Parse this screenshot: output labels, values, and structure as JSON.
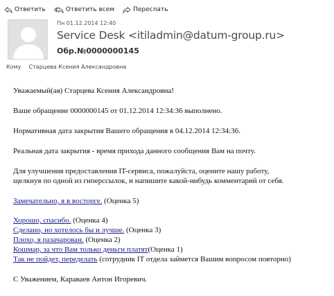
{
  "toolbar": {
    "reply": "Ответить",
    "reply_all": "Ответить всем",
    "forward": "Переслать"
  },
  "header": {
    "date": "Пн 01.12.2014 12:40",
    "sender": "Service Desk <itiladmin@datum-group.ru>",
    "subject": "Обр.№0000000145",
    "to_label": "Кому",
    "to_value": "Старцева Ксения Александровна"
  },
  "body": {
    "greeting": "Уважаемый(ая) Старцева Ксения Александровна!",
    "completed": "Ваше обращение 0000000145 от 01.12.2014 12:34:36 выполнено.",
    "normative": "Нормативная дата закрытия Вашего обращения в 04.12.2014 12:34:36.",
    "actual": "Реальная дата закрытия - время прихода данного сообщения Вам на почту.",
    "improve_1": "Для улучшения предоставления  IT-сервиса, пожалуйста, оцените нашу работу,",
    "improve_2": "щелкнув по одной из гиперссылок, и напишите какой-нибудь комментарий от себя.",
    "ratings": [
      {
        "link": "Замечательно, я в восторге.",
        "note": " (Оценка 5)"
      },
      {
        "link": "Хорошо, спасибо.",
        "note": " (Оценка 4)"
      },
      {
        "link": "Сделано, но хотелось бы и лучше.",
        "note": " (Оценка 3)"
      },
      {
        "link": "Плохо, я разачарован.",
        "note": " (Оценка 2)"
      },
      {
        "link": "Кошмар, за что Вам только деньги платят",
        "note": "(Оценка 1)"
      },
      {
        "link": "Так не пойдет, переделать",
        "note": " (сотрудник  IT отдела займется Вашим вопросом повторно)"
      }
    ],
    "signature": "С Уважением, Караваев Антон Игоревич."
  }
}
